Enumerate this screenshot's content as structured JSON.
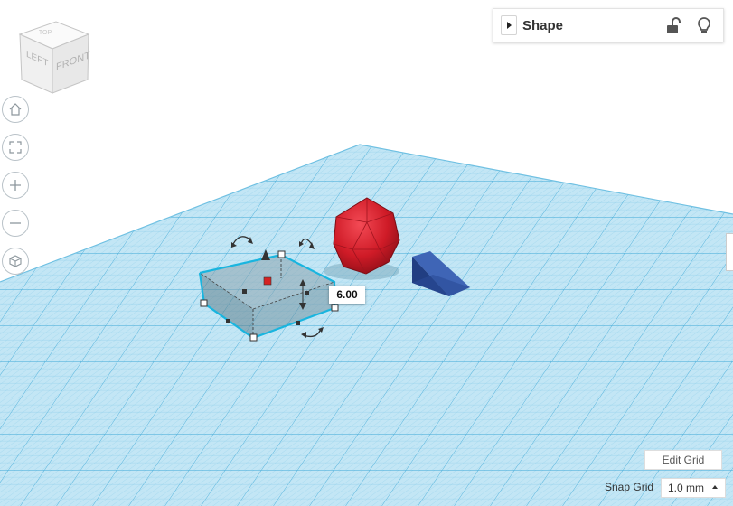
{
  "viewcube": {
    "left_label": "LEFT",
    "front_label": "FRONT"
  },
  "shape_panel": {
    "title": "Shape",
    "icons": [
      "expand-arrow-icon",
      "unlock-icon",
      "lightbulb-icon"
    ]
  },
  "nav": {
    "buttons": [
      "home-view",
      "fit-all",
      "zoom-in",
      "zoom-out",
      "projection-toggle"
    ]
  },
  "selection": {
    "height_value": "6.00"
  },
  "grid": {
    "edit_label": "Edit Grid",
    "snap_label": "Snap Grid",
    "snap_value": "1.0 mm"
  },
  "colors": {
    "grid_fill": "#bfe3f3",
    "grid_line": "#58b7df",
    "selection": "#1ab6e0",
    "sphere": "#d11e2a",
    "wedge": "#2c4f9e"
  }
}
